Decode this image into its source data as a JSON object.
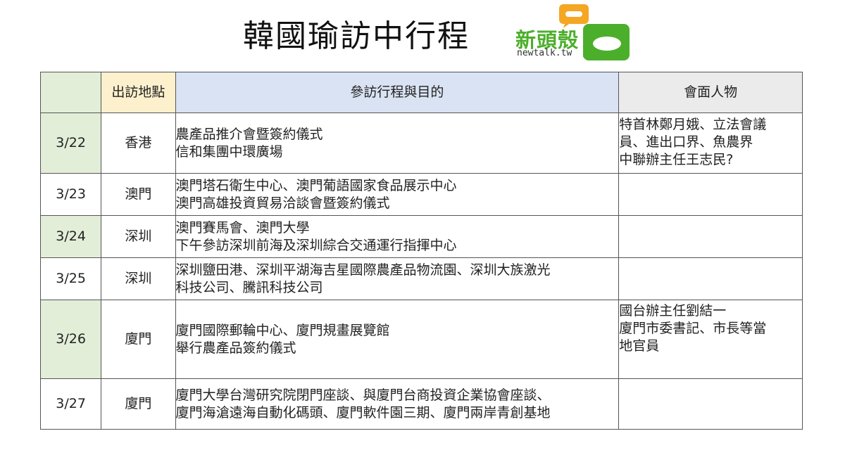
{
  "title": "韓國瑜訪中行程",
  "logo": {
    "text": "新頭殼",
    "sub": "newtalk.tw",
    "colors": {
      "green": "#4caf2c",
      "orange": "#f5a623"
    }
  },
  "table": {
    "headers": {
      "date": "",
      "place": "出訪地點",
      "plan": "參訪行程與目的",
      "people": "會面人物"
    },
    "header_colors": {
      "date": "#e3eed9",
      "place": "#fdf0cc",
      "plan": "#dae3f3",
      "people": "#ebebeb"
    },
    "rows": [
      {
        "date": "3/22",
        "place": "香港",
        "plan": [
          "農產品推介會暨簽約儀式",
          "信和集團中環廣場"
        ],
        "people": [
          "特首林鄭月娥、立法會議",
          "員、進出口界、魚農界",
          "中聯辦主任王志民?"
        ]
      },
      {
        "date": "3/23",
        "place": "澳門",
        "plan": [
          "澳門塔石衛生中心、澳門葡語國家食品展示中心",
          "澳門高雄投資貿易洽談會暨簽約儀式"
        ],
        "people": []
      },
      {
        "date": "3/24",
        "place": "深圳",
        "plan": [
          "澳門賽馬會、澳門大學",
          "下午參訪深圳前海及深圳綜合交通運行指揮中心"
        ],
        "people": []
      },
      {
        "date": "3/25",
        "place": "深圳",
        "plan": [
          "深圳鹽田港、深圳平湖海吉星國際農產品物流園、深圳大族激光",
          "科技公司、騰訊科技公司"
        ],
        "people": []
      },
      {
        "date": "3/26",
        "place": "廈門",
        "plan": [
          "廈門國際郵輪中心、廈門規畫展覽館",
          "舉行農產品簽約儀式"
        ],
        "people": [
          "國台辦主任劉結一",
          "廈門市委書記、市長等當",
          "地官員"
        ]
      },
      {
        "date": "3/27",
        "place": "廈門",
        "plan": [
          "廈門大學台灣研究院閉門座談、與廈門台商投資企業協會座談、",
          "廈門海滄遠海自動化碼頭、廈門軟件園三期、廈門兩岸青創基地"
        ],
        "people": []
      }
    ]
  }
}
